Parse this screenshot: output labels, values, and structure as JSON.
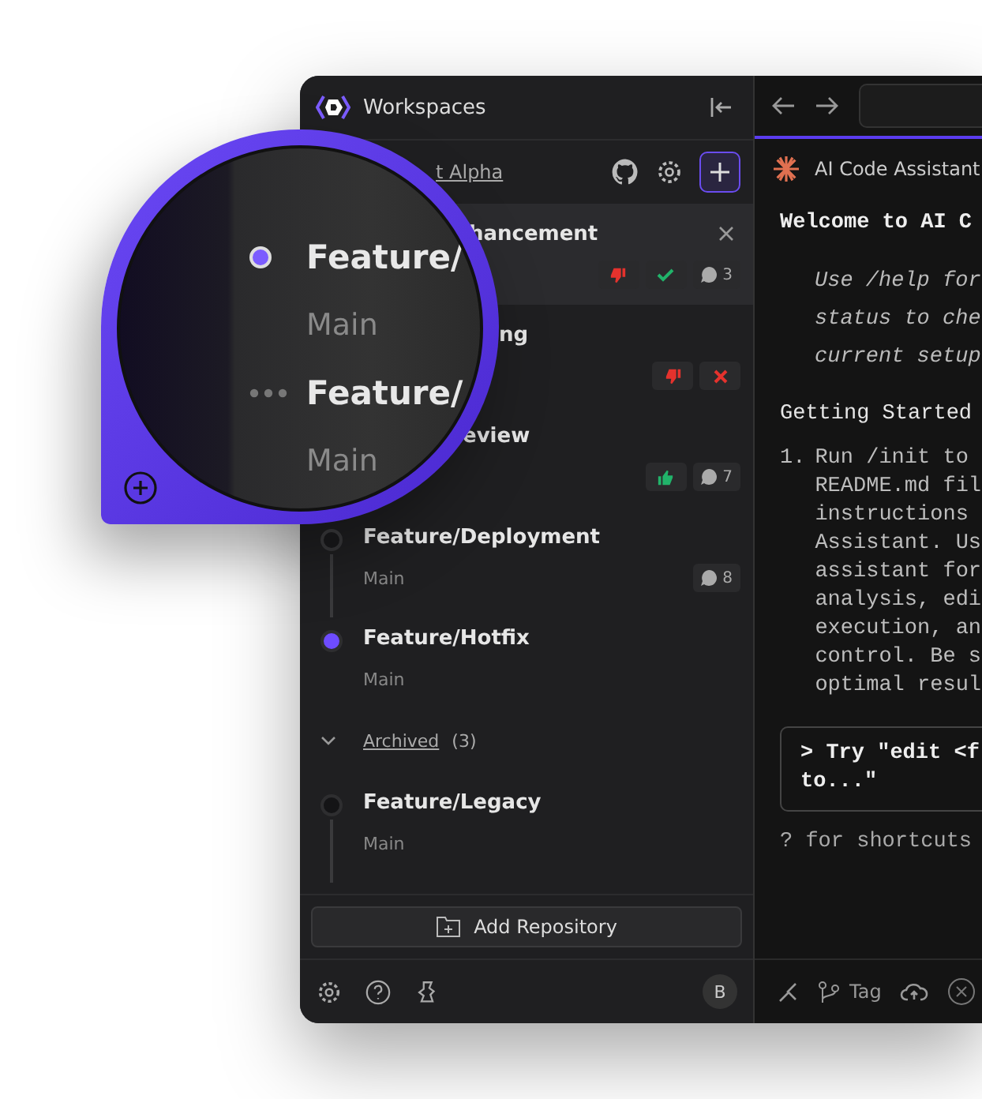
{
  "sidebar": {
    "title": "Workspaces",
    "repository": {
      "name": "t Alpha"
    },
    "workspaces": [
      {
        "title": "hancement",
        "selected": true,
        "badges": [
          {
            "kind": "dislike"
          },
          {
            "kind": "approved"
          },
          {
            "kind": "comments",
            "count": "3"
          }
        ]
      },
      {
        "title": "ng",
        "selected": false,
        "badges": [
          {
            "kind": "dislike"
          },
          {
            "kind": "rejected"
          }
        ]
      },
      {
        "title": "eview",
        "selected": false,
        "badges": [
          {
            "kind": "like"
          },
          {
            "kind": "comments",
            "count": "7"
          }
        ]
      },
      {
        "title": "Feature/Deployment",
        "subtitle": "Main",
        "active": false,
        "selected": false,
        "badges": [
          {
            "kind": "comments",
            "count": "8"
          }
        ]
      },
      {
        "title": "Feature/Hotfix",
        "subtitle": "Main",
        "active": true,
        "selected": false
      }
    ],
    "archived": {
      "label": "Archived",
      "count": "(3)",
      "expanded": true,
      "items": [
        {
          "title": "Feature/Legacy",
          "subtitle": "Main",
          "active": false
        }
      ]
    },
    "add_button": "Add Repository",
    "avatar": "B"
  },
  "lens": {
    "items": [
      {
        "title": "Feature/",
        "subtitle": "Main",
        "kind": "dot"
      },
      {
        "title": "Feature/",
        "subtitle": "Main",
        "kind": "dots"
      }
    ]
  },
  "assistant": {
    "tab": "AI Code Assistant",
    "heading": "Welcome to AI C",
    "hint_lines": [
      "Use /help for",
      "status to che",
      "current setup"
    ],
    "section": "Getting Started",
    "steps": [
      {
        "number": "1.",
        "lines": [
          "Run /init to",
          "README.md fil",
          "instructions",
          "Assistant. Us",
          "assistant for",
          "analysis, edi",
          "execution, an",
          "control. Be s",
          "optimal resul"
        ]
      }
    ],
    "prompt_lines": [
      "> Try \"edit <f",
      "to...\""
    ],
    "shortcut": "? for shortcuts",
    "tag": "Tag"
  }
}
